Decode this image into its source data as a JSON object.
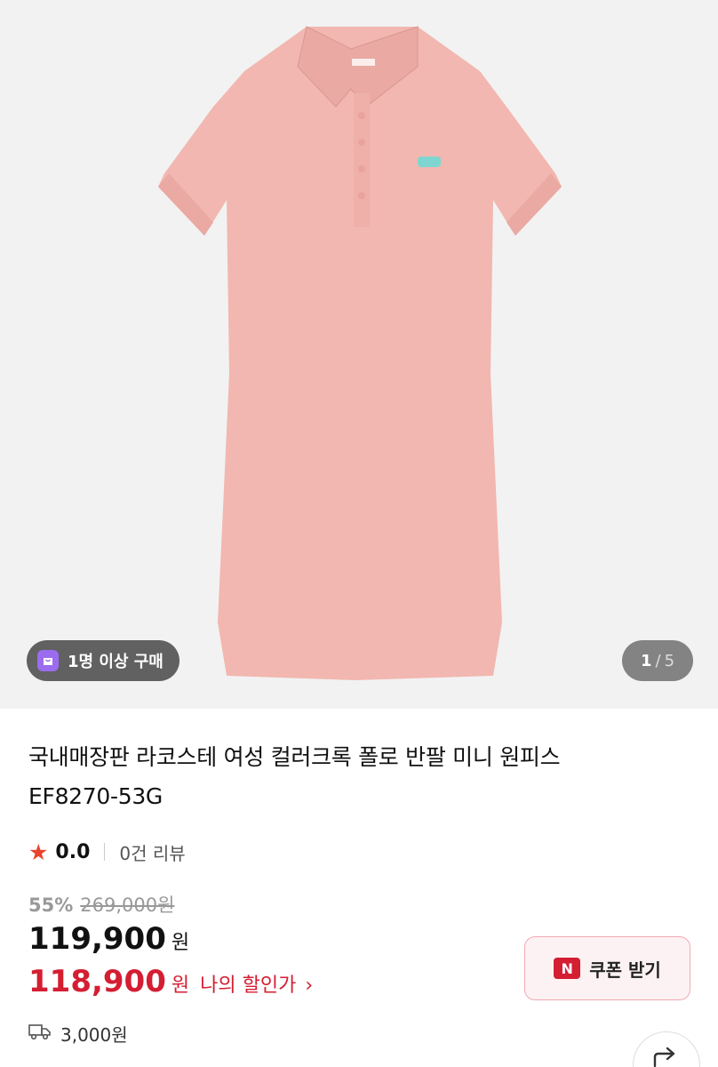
{
  "gallery": {
    "badge_label": "1명 이상 구매",
    "current_index": "1",
    "separator": "/",
    "total": "5"
  },
  "product": {
    "title_line1": "국내매장판 라코스테 여성 컬러크록 폴로 반팔 미니 원피스",
    "title_line2": "EF8270-53G",
    "rating_score": "0.0",
    "review_count": "0건 리뷰",
    "discount_percent": "55%",
    "original_price": "269,000원",
    "sale_price": "119,900",
    "currency": "원",
    "my_price": "118,900",
    "my_price_label": "나의 할인가",
    "my_price_chevron": "›",
    "shipping_fee": "3,000원"
  },
  "coupon": {
    "icon_letter": "N",
    "label": "쿠폰 받기"
  },
  "icons": {
    "star": "star-icon",
    "truck": "truck-icon",
    "share": "share-icon",
    "bag": "shopping-bag-icon"
  },
  "colors": {
    "dress": "#f2b7b0",
    "accent_red": "#d41e32",
    "star": "#e8442d",
    "badge_purple": "#9b6cf0"
  }
}
